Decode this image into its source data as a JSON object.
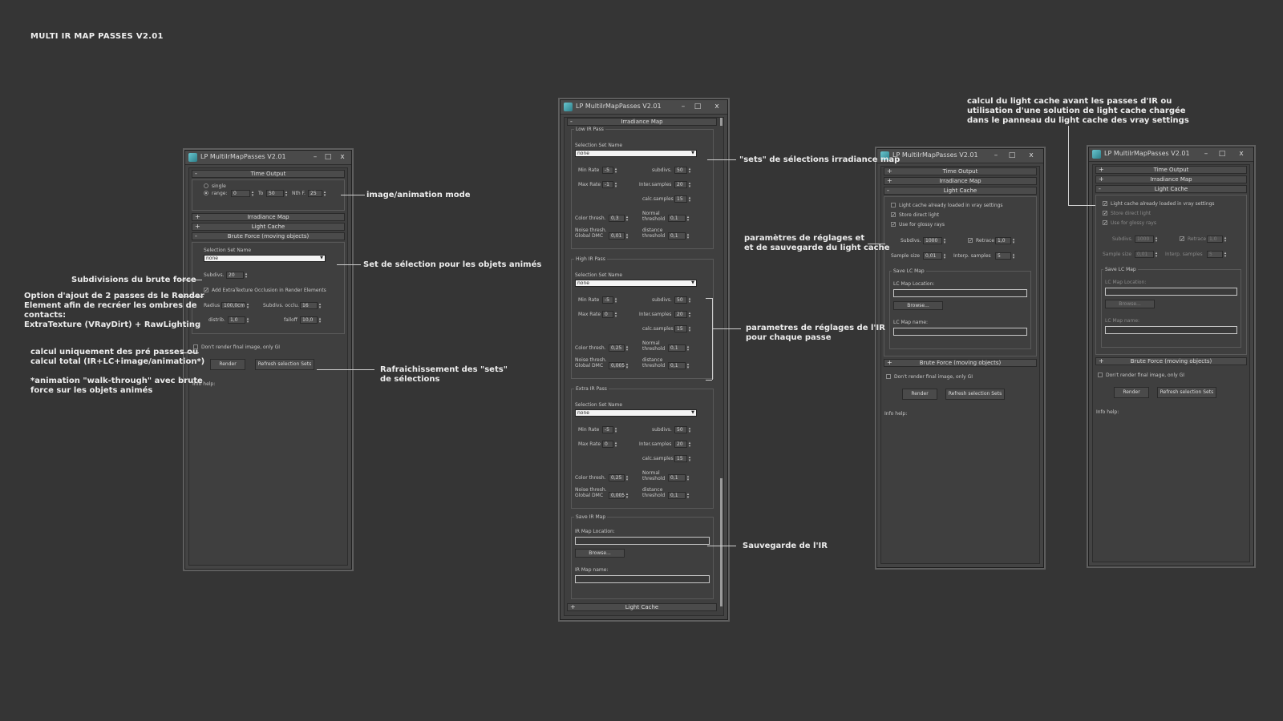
{
  "page_title": "MULTI IR MAP PASSES V2.01",
  "window_title": "LP MultiIrMapPasses V2.01",
  "window_controls": {
    "minimize": "–",
    "maximize": "□",
    "close": "x"
  },
  "rollouts": {
    "time_output": "Time Output",
    "irradiance_map": "Irradiance Map",
    "light_cache": "Light Cache",
    "brute_force": "Brute Force (moving objects)",
    "expand_sign": "+",
    "collapse_sign": "-"
  },
  "time_output": {
    "single": "single",
    "range": "range:",
    "range_from": "0",
    "to_label": "To",
    "range_to": "50",
    "nth_label": "Nth F.",
    "nth_value": "25"
  },
  "brute_force": {
    "selection_set_label": "Selection Set Name",
    "selection_value": "none",
    "subdivs_label": "Subdivs.",
    "subdivs_value": "20",
    "extra_texture_label": "Add ExtraTexture Occlusion in Render Elements",
    "radius_label": "Radius",
    "radius_value": "100,0cm",
    "subdivs_occlu_label": "Subdivs. occlu.",
    "subdivs_occlu_value": "16",
    "distrib_label": "distrib.",
    "distrib_value": "1,0",
    "falloff_label": "falloff",
    "falloff_value": "10,0"
  },
  "common": {
    "dont_render": "Don't render final image, only GI",
    "render_button": "Render",
    "refresh_button": "Refresh selection Sets",
    "info_help": "Info help:"
  },
  "irmap": {
    "selection_set_label": "Selection Set Name",
    "min_rate": "Min Rate",
    "max_rate": "Max Rate",
    "subdivs": "subdivs.",
    "inter_samples": "Inter.samples",
    "calc_samples": "calc.samples",
    "color_thresh": "Color thresh.",
    "normal_threshold_1": "Normal",
    "normal_threshold_2": "threshold",
    "noise_thresh_1": "Noise thresh.",
    "noise_thresh_2": "Global DMC",
    "distance_threshold_1": "distance",
    "distance_threshold_2": "threshold",
    "passes": [
      {
        "name": "Low IR Pass",
        "selection": "none",
        "min_rate": "-5",
        "max_rate": "-1",
        "subdivs": "50",
        "inter_samples": "20",
        "calc_samples": "15",
        "color_thresh": "0,3",
        "normal_threshold": "0,1",
        "noise_thresh": "0,01",
        "distance_threshold": "0,1"
      },
      {
        "name": "High IR Pass",
        "selection": "none",
        "min_rate": "-5",
        "max_rate": "0",
        "subdivs": "50",
        "inter_samples": "20",
        "calc_samples": "15",
        "color_thresh": "0,25",
        "normal_threshold": "0,1",
        "noise_thresh": "0,005",
        "distance_threshold": "0,1"
      },
      {
        "name": "Extra IR Pass",
        "selection": "none",
        "min_rate": "-5",
        "max_rate": "0",
        "subdivs": "50",
        "inter_samples": "20",
        "calc_samples": "15",
        "color_thresh": "0,25",
        "normal_threshold": "0,1",
        "noise_thresh": "0,005",
        "distance_threshold": "0,1"
      }
    ],
    "save_group": "Save IR Map",
    "location_label": "IR Map Location:",
    "browse": "Browse...",
    "name_label": "IR Map name:"
  },
  "light_cache": {
    "already_loaded": "Light cache already loaded in vray settings",
    "store_direct": "Store direct light",
    "use_glossy": "Use for glossy rays",
    "subdivs_label": "Subdivs.",
    "subdivs_value": "1000",
    "retrace_label": "Retrace",
    "retrace_value": "1,0",
    "sample_size_label": "Sample size",
    "sample_size_value": "0,01",
    "interp_label": "Interp. samples",
    "interp_value": "5",
    "save_group": "Save LC Map",
    "location_label": "LC Map Location:",
    "browse": "Browse...",
    "name_label": "LC Map name:"
  },
  "annotations": {
    "image_mode": "image/animation mode",
    "selection_anim": "Set de sélection pour les objets animés",
    "subdivs_bf": "Subdivisions du brute force",
    "option_lines": [
      "Option d'ajout de 2 passes ds le Render",
      "Element afin de recréer les ombres de",
      "contacts:",
      "ExtraTexture (VRayDirt) + RawLighting"
    ],
    "calc_lines": [
      "calcul uniquement des pré passes ou",
      "calcul total (IR+LC+image/animation*)"
    ],
    "anim_lines": [
      "*animation \"walk-through\" avec brute",
      "force sur les objets animés"
    ],
    "refresh_lines": [
      "Rafraichissement des \"sets\"",
      "de sélections"
    ],
    "sets_irmap": "\"sets\" de sélections irradiance map",
    "params_ir_lines": [
      "parametres de réglages de l'IR",
      "pour chaque passe"
    ],
    "save_ir": "Sauvegarde de l'IR",
    "params_lc_lines": [
      "paramètres de réglages et",
      "et de sauvegarde du light cache"
    ],
    "lc_before_lines": [
      "calcul du light cache avant les passes d'IR ou",
      "utilisation d'une solution de light cache chargée",
      "dans le panneau du light cache des vray settings"
    ]
  }
}
